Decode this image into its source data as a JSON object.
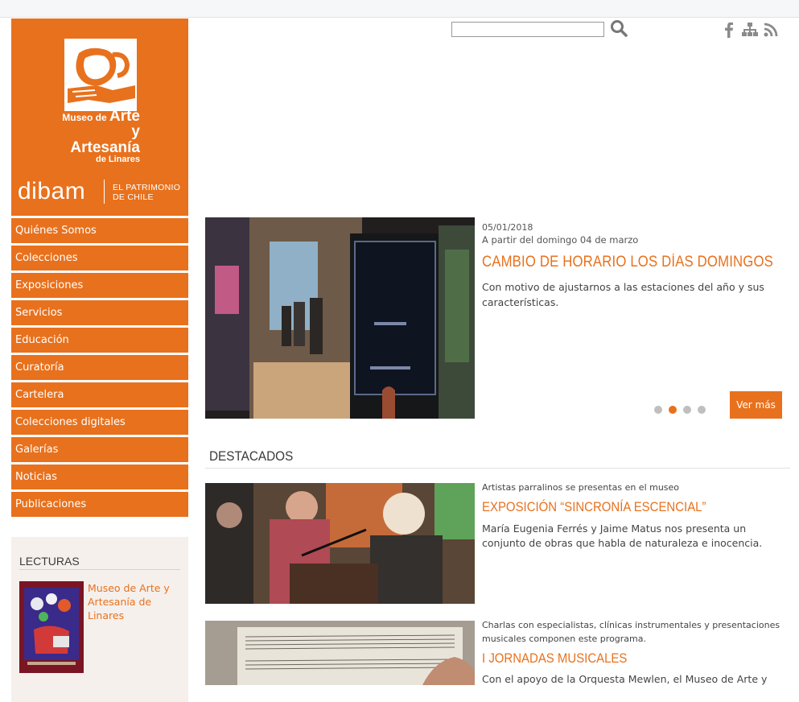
{
  "brand": {
    "museum_line1_small": "Museo de",
    "museum_line1_big": "Arte",
    "museum_line2": "y Artesanía",
    "museum_line3": "de Linares",
    "dibam_word": "dibam",
    "dibam_tag_line1": "EL PATRIMONIO",
    "dibam_tag_line2": "DE CHILE",
    "color": "#e8711d"
  },
  "search": {
    "value": "",
    "placeholder": ""
  },
  "social": [
    "facebook-icon",
    "sitemap-icon",
    "rss-icon"
  ],
  "menu": [
    "Quiénes Somos",
    "Colecciones",
    "Exposiciones",
    "Servicios",
    "Educación",
    "Curatoría",
    "Cartelera",
    "Colecciones digitales",
    "Galerías",
    "Noticias",
    "Publicaciones"
  ],
  "lecturas": {
    "title": "LECTURAS",
    "book_title": "Museo de Arte y Artesanía de Linares"
  },
  "slider": {
    "date": "05/01/2018",
    "subtitle": "A partir del domingo 04 de marzo",
    "title": "CAMBIO DE HORARIO LOS DÍAS DOMINGOS",
    "description": "Con motivo de ajustarnos a las estaciones del año y sus características.",
    "button": "Ver más",
    "dots_total": 4,
    "dots_active": 2
  },
  "destacados": {
    "title": "DESTACADOS",
    "items": [
      {
        "kicker": "Artistas parralinos se presentas en el museo",
        "title": "EXPOSICIÓN “SINCRONÍA ESCENCIAL”",
        "description": "María Eugenia Ferrés y Jaime Matus nos presenta un conjunto de obras que habla de naturaleza e inocencia."
      },
      {
        "kicker": "Charlas con especialistas, clínicas instrumentales y presentaciones musicales componen este programa.",
        "title": "I JORNADAS MUSICALES",
        "description": "Con el apoyo de la Orquesta Mewlen, el Museo de Arte y"
      }
    ]
  }
}
